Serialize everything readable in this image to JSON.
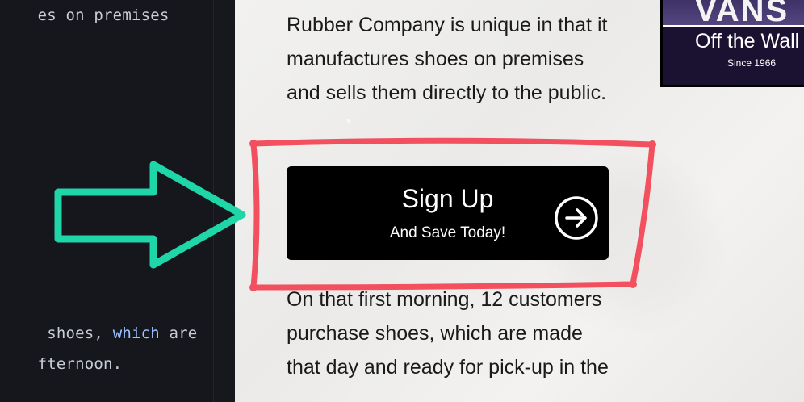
{
  "editor": {
    "lines": [
      {
        "pre": "es on premises",
        "kw": "",
        "post": ""
      },
      {
        "pre": " shoes, ",
        "kw": "which",
        "post": " are"
      },
      {
        "pre": "fternoon.",
        "kw": "",
        "post": ""
      }
    ]
  },
  "content": {
    "paragraph_top": "Rubber Company is unique in that it manufactures shoes on premises and sells them directly to the public.",
    "paragraph_bottom": "On that first morning, 12 customers purchase shoes, which are made that day and ready for pick-up in the"
  },
  "signup": {
    "title": "Sign Up",
    "subtitle": "And Save Today!"
  },
  "logo": {
    "brand": "VANS",
    "tagline": "Off the Wall",
    "since": "Since 1966"
  },
  "annotations": {
    "arrow_color": "#1fd6a8",
    "highlight_color": "#f2505f"
  },
  "icons": {
    "signup_icon": "arrow-circle-right-icon",
    "pointer": "callout-arrow-icon"
  }
}
